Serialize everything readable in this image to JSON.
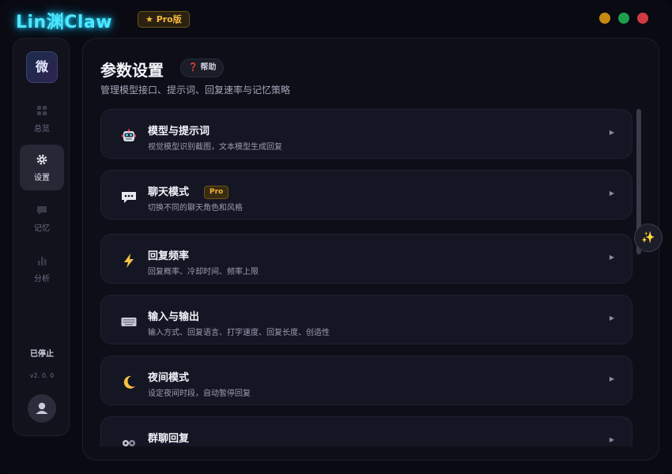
{
  "app": {
    "title": "Lin渊Claw",
    "edition": "★ Pro版"
  },
  "window": {
    "colors": {
      "minimize": "#c98a12",
      "maximize": "#1e9e4c",
      "close": "#d23b45"
    }
  },
  "sidebar": {
    "avatar": "微",
    "items": [
      {
        "label": "总览",
        "icon": "dashboard-icon",
        "active": false
      },
      {
        "label": "设置",
        "icon": "gear-icon",
        "active": true
      },
      {
        "label": "记忆",
        "icon": "chat-bubble-icon",
        "active": false
      },
      {
        "label": "分析",
        "icon": "bar-chart-icon",
        "active": false
      }
    ],
    "status": "已停止",
    "version": "v2. 0. 0",
    "user_icon": "user-icon"
  },
  "main": {
    "title": "参数设置",
    "help_label": "帮助",
    "subtitle": "管理模型接口、提示词、回复速率与记忆策略",
    "cards": [
      {
        "title": "模型与提示词",
        "desc": "视觉模型识别截图，文本模型生成回复",
        "icon": "robot-icon"
      },
      {
        "title": "聊天模式",
        "desc": "切换不同的聊天角色和风格",
        "icon": "speech-bubble-icon",
        "badge": "Pro"
      },
      {
        "title": "回复频率",
        "desc": "回复概率、冷却时间、频率上限",
        "icon": "lightning-icon"
      },
      {
        "title": "输入与输出",
        "desc": "输入方式、回复语言、打字速度、回复长度、创造性",
        "icon": "keyboard-icon"
      },
      {
        "title": "夜间模式",
        "desc": "设定夜间时段，自动暂停回复",
        "icon": "moon-icon"
      },
      {
        "title": "群聊回复",
        "desc": "",
        "icon": "group-icon"
      }
    ]
  },
  "fab": {
    "icon": "sparkle-icon"
  },
  "colors": {
    "accent": "#4fe6ff",
    "pro": "#f5b93c",
    "danger": "#e53c4a"
  }
}
